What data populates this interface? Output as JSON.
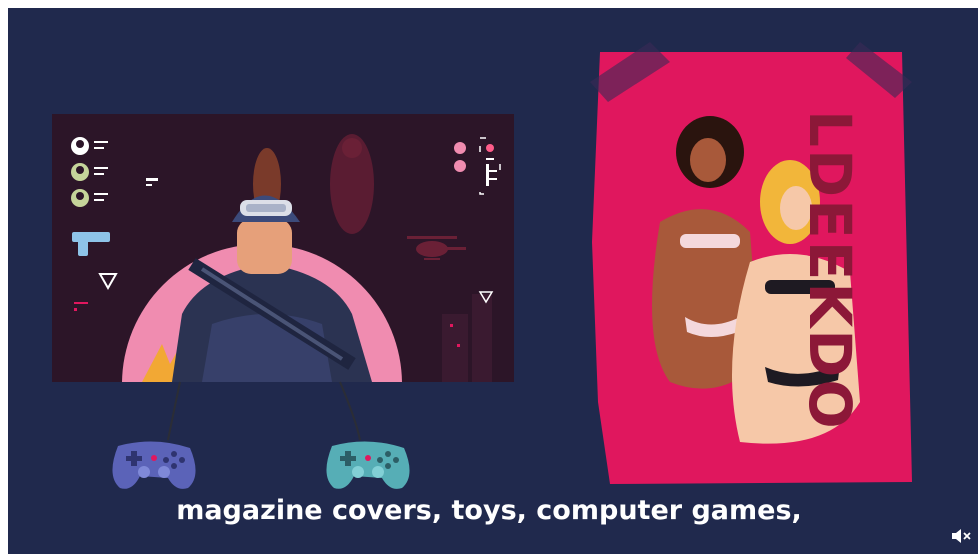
{
  "caption": "magazine covers, toys, computer games,",
  "magazine": {
    "title": "LDEEKDO"
  },
  "icons": {
    "controllers": [
      "gamepad-icon",
      "gamepad-icon"
    ],
    "hud": [
      "avatar-icon",
      "pistol-icon",
      "helicopter-icon",
      "triangle-marker-icon"
    ],
    "mute": "speaker-muted-icon"
  },
  "colors": {
    "background": "#20294d",
    "game_screen": "#2c1528",
    "magazine": "#e0175e",
    "magazine_title": "#8c1838",
    "caption": "#ffffff"
  }
}
